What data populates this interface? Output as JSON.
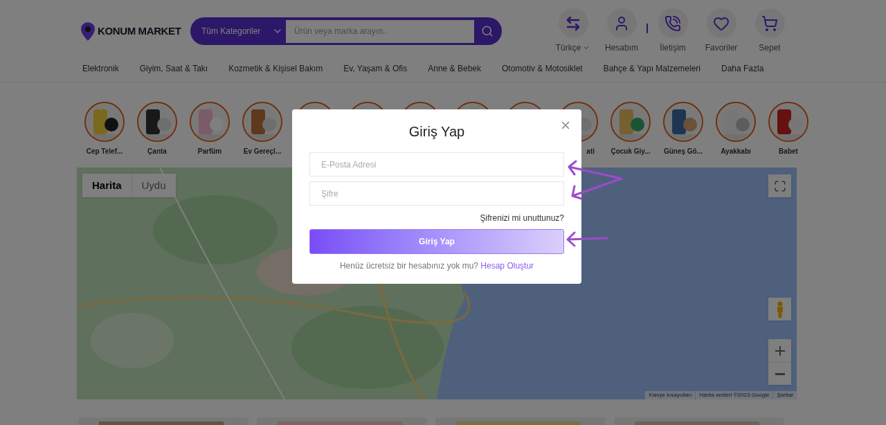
{
  "header": {
    "logo": "KONUM MARKET",
    "search": {
      "category": "Tüm Kategoriler",
      "placeholder": "Ürün veya marka arayın.."
    },
    "actions": [
      {
        "kind": "language",
        "label": "Türkçe"
      },
      {
        "kind": "account",
        "label": "Hesabım"
      },
      {
        "kind": "contact",
        "label": "İletişim"
      },
      {
        "kind": "favorites",
        "label": "Favoriler"
      },
      {
        "kind": "cart",
        "label": "Sepet"
      }
    ]
  },
  "nav": [
    "Elektronik",
    "Giyim, Saat & Takı",
    "Kozmetik & Kişisel Bakım",
    "Ev, Yaşam & Ofis",
    "Anne & Bebek",
    "Otomotiv & Motosiklet",
    "Bahçe & Yapı Malzemeleri",
    "Daha Fazla"
  ],
  "categories": [
    {
      "kind": "picture",
      "label": "Cep Telef...",
      "cut": false
    },
    {
      "kind": "picture",
      "label": "Çanta",
      "cut": false
    },
    {
      "kind": "picture",
      "label": "Parfüm",
      "cut": false
    },
    {
      "kind": "picture",
      "label": "Ev Gereçl...",
      "cut": false
    },
    {
      "kind": "picture"
    },
    {
      "kind": "picture"
    },
    {
      "kind": "picture"
    },
    {
      "kind": "picture"
    },
    {
      "kind": "picture"
    },
    {
      "kind": "picture",
      "label": "ati",
      "cut": true
    },
    {
      "kind": "picture",
      "label": "Çocuk Giy...",
      "cut": false
    },
    {
      "kind": "picture",
      "label": "Güneş Gö...",
      "cut": false
    },
    {
      "kind": "picture",
      "label": "Ayakkabı",
      "cut": false
    },
    {
      "kind": "picture",
      "label": "Babet",
      "cut": false
    }
  ],
  "map": {
    "types": [
      {
        "label": "Harita",
        "selected": true
      },
      {
        "label": "Uydu",
        "selected": false
      }
    ],
    "attribution": [
      "Klavye kısayolları",
      "Harita verileri ©2023 Google",
      "Şartlar"
    ]
  },
  "modal": {
    "title": "Giriş Yap",
    "email_placeholder": "E-Posta Adresi",
    "password_placeholder": "Şifre",
    "forgot": "Şifrenizi mi unuttunuz?",
    "submit": "Giriş Yap",
    "signup_prompt": "Henüz ücretsiz bir hesabınız yok mu?",
    "signup_link": "Hesap Oluştur"
  }
}
